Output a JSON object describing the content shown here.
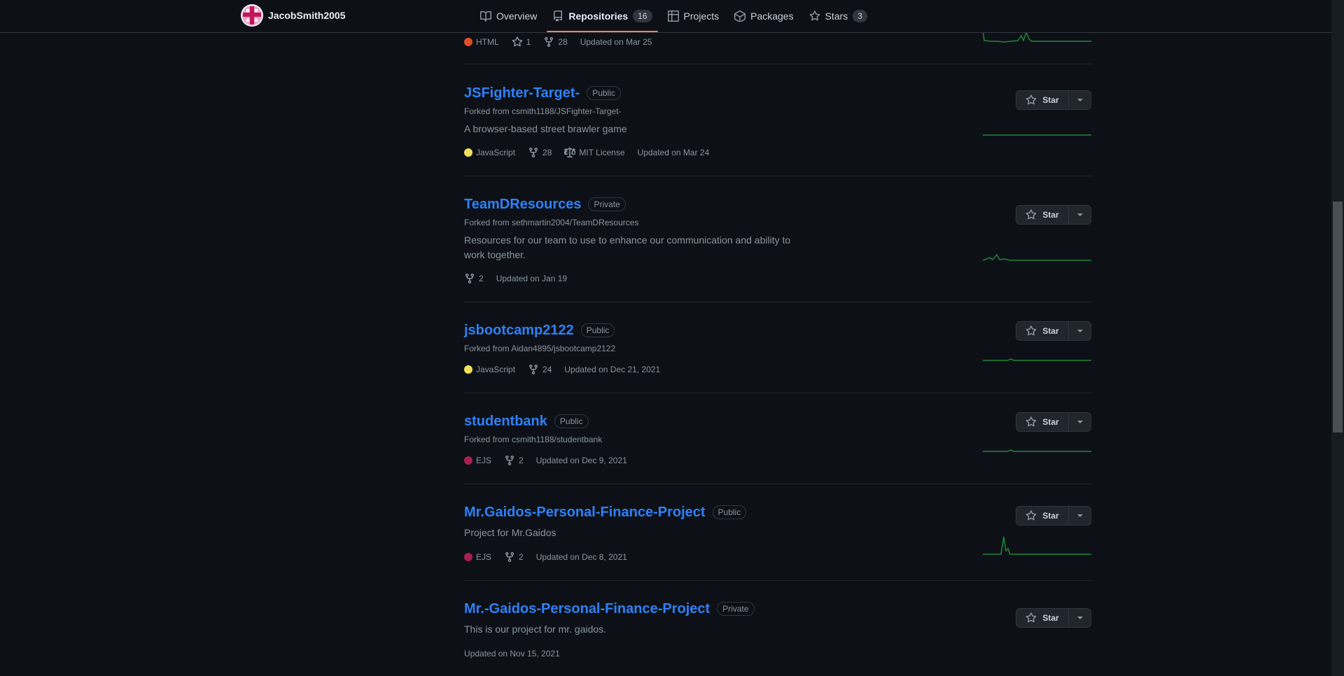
{
  "header": {
    "username": "JacobSmith2005",
    "nav": [
      {
        "label": "Overview"
      },
      {
        "label": "Repositories",
        "count": "16"
      },
      {
        "label": "Projects"
      },
      {
        "label": "Packages"
      },
      {
        "label": "Stars",
        "count": "3"
      }
    ]
  },
  "colors": {
    "accent_tab": "#f78166",
    "link": "#2f81f7",
    "html": "#e34c26",
    "javascript": "#f1e05a",
    "ejs": "#a91e50",
    "sparkline": "#238636"
  },
  "star_label": "Star",
  "top_repo": {
    "language": "HTML",
    "stars": "1",
    "forks": "28",
    "updated": "Updated on Mar 25"
  },
  "repos": [
    {
      "name": "JSFighter-Target-",
      "visibility": "Public",
      "forked_prefix": "Forked from",
      "forked_from": "csmith1188/JSFighter-Target-",
      "description": "A browser-based street brawler game",
      "language": "JavaScript",
      "forks": "28",
      "license": "MIT License",
      "updated": "Updated on Mar 24"
    },
    {
      "name": "TeamDResources",
      "visibility": "Private",
      "forked_prefix": "Forked from",
      "forked_from": "sethmartin2004/TeamDResources",
      "description": "Resources for our team to use to enhance our communication and ability to work together.",
      "forks": "2",
      "updated": "Updated on Jan 19"
    },
    {
      "name": "jsbootcamp2122",
      "visibility": "Public",
      "forked_prefix": "Forked from",
      "forked_from": "Aidan4895/jsbootcamp2122",
      "language": "JavaScript",
      "forks": "24",
      "updated": "Updated on Dec 21, 2021"
    },
    {
      "name": "studentbank",
      "visibility": "Public",
      "forked_prefix": "Forked from",
      "forked_from": "csmith1188/studentbank",
      "language": "EJS",
      "forks": "2",
      "updated": "Updated on Dec 9, 2021"
    },
    {
      "name": "Mr.Gaidos-Personal-Finance-Project",
      "visibility": "Public",
      "description": "Project for Mr.Gaidos",
      "language": "EJS",
      "forks": "2",
      "updated": "Updated on Dec 8, 2021"
    },
    {
      "name": "Mr.-Gaidos-Personal-Finance-Project",
      "visibility": "Private",
      "description": "This is our project for mr. gaidos.",
      "updated": "Updated on Nov 15, 2021"
    }
  ]
}
